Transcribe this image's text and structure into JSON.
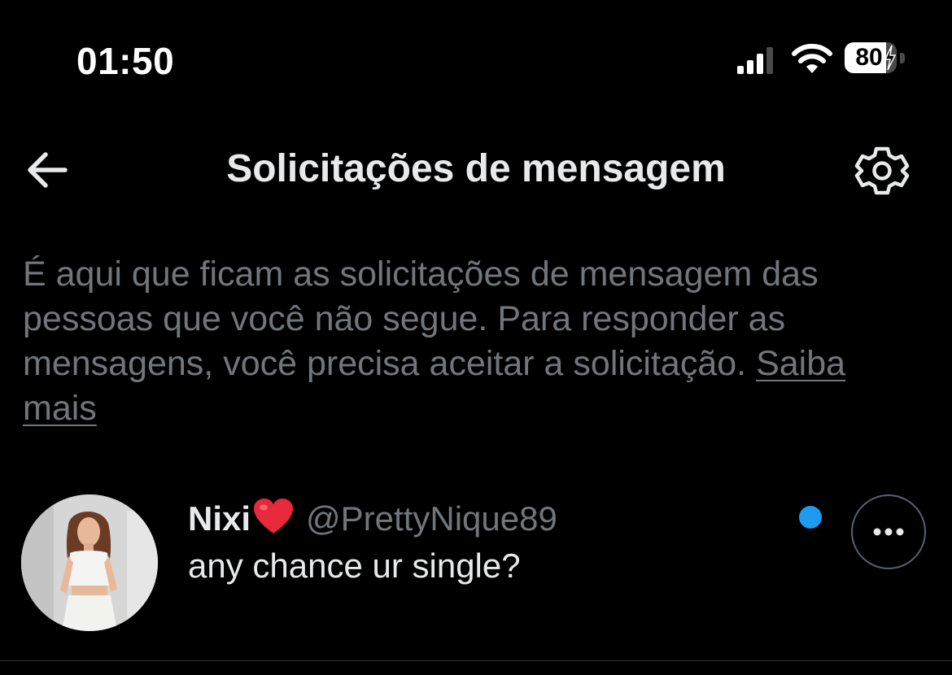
{
  "status_bar": {
    "time": "01:50",
    "battery_percent": "80",
    "battery_level": 0.8,
    "icons": [
      "cellular-signal-icon",
      "wifi-icon",
      "battery-charging-icon"
    ]
  },
  "header": {
    "title": "Solicitações de mensagem",
    "back_icon": "arrow-left-icon",
    "settings_icon": "gear-icon"
  },
  "info": {
    "text": "É aqui que ficam as solicitações de mensagem das pessoas que você não segue. Para responder as mensagens, você precisa aceitar a solicitação.",
    "link_label": "Saiba mais"
  },
  "requests": [
    {
      "name": "Nixi",
      "name_emoji": "red-heart-icon",
      "handle": "@PrettyNique89",
      "message": "any chance ur single?",
      "unread": true,
      "more_icon": "more-horizontal-icon"
    }
  ],
  "colors": {
    "background": "#000000",
    "primary_text": "#e7e9ea",
    "secondary_text": "#71767b",
    "accent": "#1d9bf0",
    "heart": "#e8283b",
    "divider": "#2f3336"
  }
}
